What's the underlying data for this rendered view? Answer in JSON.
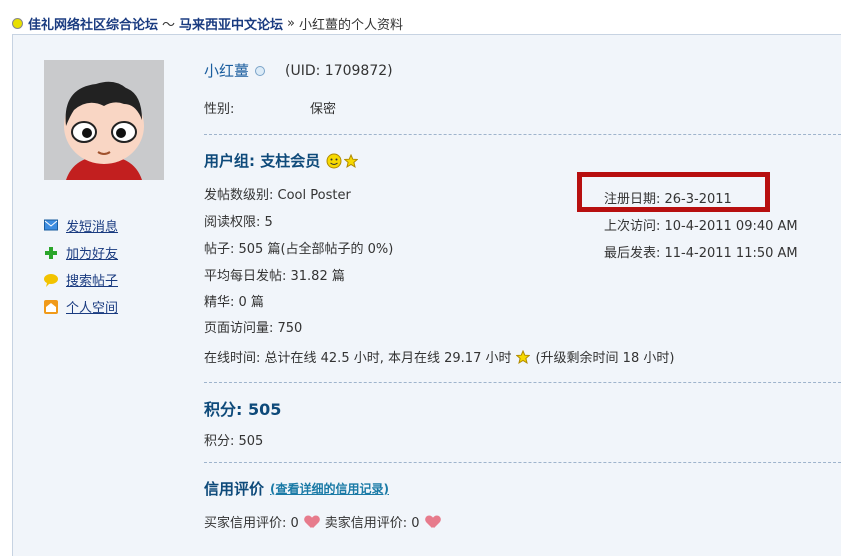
{
  "breadcrumb": {
    "forum": "佳礼网络社区综合论坛",
    "tilde": "～",
    "subforum": "马来西亚中文论坛",
    "arrow": "»",
    "current": "小红薑的个人资料"
  },
  "profile": {
    "username": "小红薑",
    "uid": "(UID: 1709872)",
    "gender_label": "性别:",
    "gender_value": "保密"
  },
  "sidebar": {
    "items": [
      {
        "label": "发短消息",
        "icon": "envelope-icon"
      },
      {
        "label": "加为好友",
        "icon": "plus-icon"
      },
      {
        "label": "搜索帖子",
        "icon": "speech-bubble-icon"
      },
      {
        "label": "个人空间",
        "icon": "home-icon"
      }
    ]
  },
  "group": {
    "title": "用户组: 支柱会员",
    "post_level": "发帖数级别: Cool Poster",
    "read_perm": "阅读权限: 5",
    "posts": "帖子: 505 篇(占全部帖子的 0%)",
    "daily_avg": "平均每日发帖: 31.82 篇",
    "digest": "精华: 0 篇",
    "page_views": "页面访问量: 750",
    "online_time": "在线时间: 总计在线 42.5 小时, 本月在线 29.17 小时",
    "upgrade": "(升级剩余时间 18 小时)",
    "reg_date": "注册日期: 26-3-2011",
    "last_visit": "上次访问: 10-4-2011 09:40 AM",
    "last_post": "最后发表: 11-4-2011 11:50 AM"
  },
  "points": {
    "title": "积分: 505",
    "value": "积分: 505"
  },
  "credit": {
    "title": "信用评价",
    "link": "(查看详细的信用记录)",
    "buyer": "买家信用评价: 0",
    "seller": "卖家信用评价: 0"
  },
  "colors": {
    "accent": "#0e4a7a",
    "link": "#1a3b80",
    "highlight": "#b70f0f"
  }
}
